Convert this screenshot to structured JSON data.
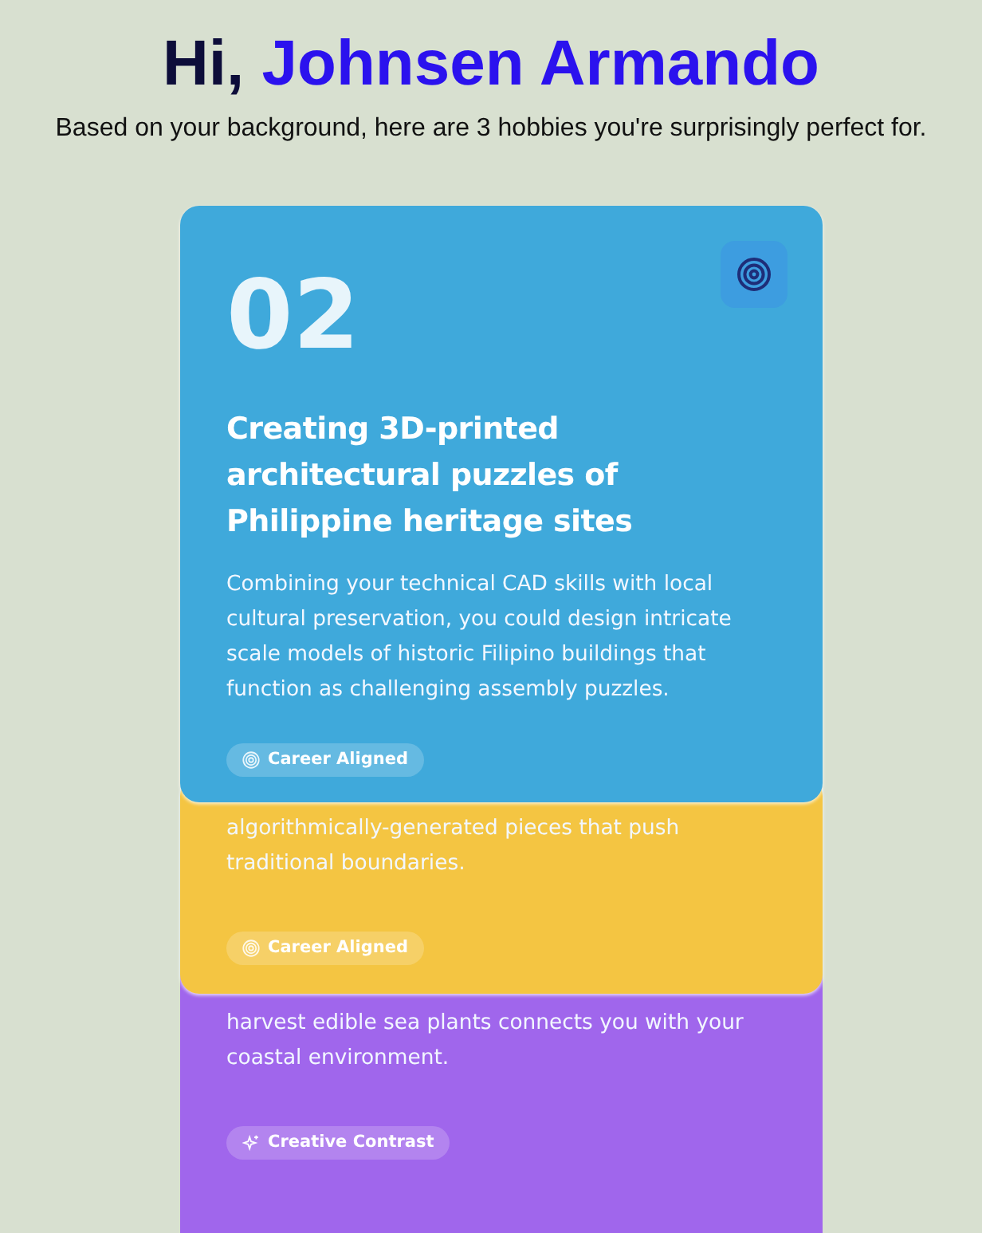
{
  "greeting": {
    "prefix": "Hi,",
    "name": "Johnsen Armando"
  },
  "subtitle": "Based on your background, here are 3 hobbies you're surprisingly perfect for.",
  "cards": [
    {
      "number": "02",
      "title": "Creating 3D-printed architectural puzzles of Philippine heritage sites",
      "description": "Combining your technical CAD skills with local cultural preservation, you could design intricate scale models of historic Filipino buildings that function as challenging assembly puzzles.",
      "badge": {
        "label": "Career Aligned",
        "kind": "target"
      },
      "color": "#3fa9db"
    },
    {
      "description": "algorithmically-generated pieces that push traditional boundaries.",
      "badge": {
        "label": "Career Aligned",
        "kind": "target"
      },
      "color": "#f4c542"
    },
    {
      "description": "harvest edible sea plants connects you with your coastal environment.",
      "badge": {
        "label": "Creative Contrast",
        "kind": "sparkle"
      },
      "color": "#a066ec"
    }
  ]
}
